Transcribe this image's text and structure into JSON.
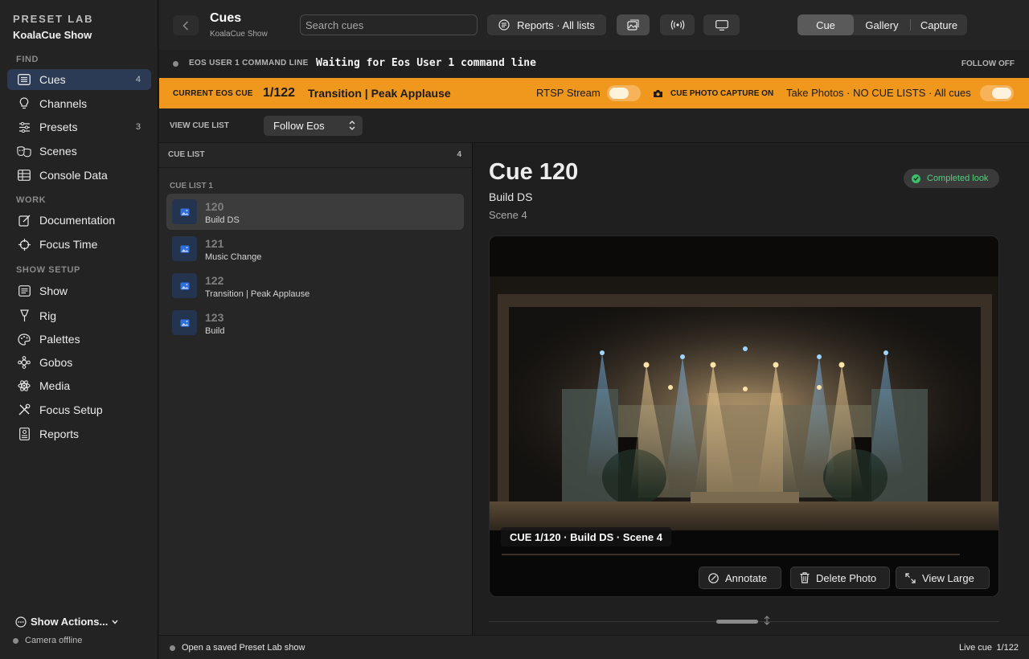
{
  "sidebar": {
    "brand": "PRESET LAB",
    "show_name": "KoalaCue Show",
    "sections": {
      "find": "FIND",
      "work": "WORK",
      "show_setup": "SHOW SETUP"
    },
    "items": {
      "cues": {
        "label": "Cues",
        "count": "4",
        "icon": "list-icon"
      },
      "channels": {
        "label": "Channels",
        "icon": "bulb-icon"
      },
      "presets": {
        "label": "Presets",
        "count": "3",
        "icon": "sliders-icon"
      },
      "scenes": {
        "label": "Scenes",
        "icon": "masks-icon"
      },
      "console_data": {
        "label": "Console Data",
        "icon": "table-icon"
      },
      "documentation": {
        "label": "Documentation",
        "icon": "edit-icon"
      },
      "focus_time": {
        "label": "Focus Time",
        "icon": "crosshair-icon"
      },
      "show": {
        "label": "Show",
        "icon": "list-icon"
      },
      "rig": {
        "label": "Rig",
        "icon": "spotlight-icon"
      },
      "palettes": {
        "label": "Palettes",
        "icon": "palette-icon"
      },
      "gobos": {
        "label": "Gobos",
        "icon": "gobo-icon"
      },
      "media": {
        "label": "Media",
        "icon": "atom-icon"
      },
      "focus_setup": {
        "label": "Focus Setup",
        "icon": "tools-icon"
      },
      "reports": {
        "label": "Reports",
        "icon": "report-icon"
      }
    },
    "show_actions": "Show Actions...",
    "camera_status": "Camera offline"
  },
  "topbar": {
    "title": "Cues",
    "subtitle": "KoalaCue Show",
    "search_placeholder": "Search cues",
    "reports_label": "Reports · All lists",
    "segments": [
      "Cue",
      "Gallery",
      "Capture"
    ],
    "active_segment": "Cue"
  },
  "command_line": {
    "label": "EOS USER 1 COMMAND LINE",
    "text": "Waiting for Eos User 1 command line",
    "follow": "FOLLOW OFF"
  },
  "current_cue_bar": {
    "label": "CURRENT EOS CUE",
    "number": "1/122",
    "name": "Transition | Peak Applause",
    "rtsp_label": "RTSP Stream",
    "capture_label": "CUE PHOTO CAPTURE ON",
    "take_photos": "Take Photos · NO CUE LISTS · All cues",
    "accent": "#f0981d"
  },
  "view_cue_list": {
    "label": "VIEW CUE LIST",
    "selected": "Follow Eos"
  },
  "cue_list": {
    "title": "CUE LIST",
    "count": "4",
    "group": "CUE LIST 1",
    "cues": [
      {
        "number": "120",
        "name": "Build DS"
      },
      {
        "number": "121",
        "name": "Music Change"
      },
      {
        "number": "122",
        "name": "Transition | Peak Applause"
      },
      {
        "number": "123",
        "name": "Build"
      }
    ],
    "selected_index": 0
  },
  "detail": {
    "title": "Cue 120",
    "name": "Build DS",
    "scene": "Scene 4",
    "badge": "Completed look",
    "caption": "CUE 1/120  ·  Build DS  ·  Scene 4",
    "buttons": {
      "annotate": "Annotate",
      "delete": "Delete Photo",
      "view_large": "View Large"
    }
  },
  "status": {
    "message": "Open a saved Preset Lab show",
    "live_label": "Live cue",
    "live_number": "1/122"
  }
}
